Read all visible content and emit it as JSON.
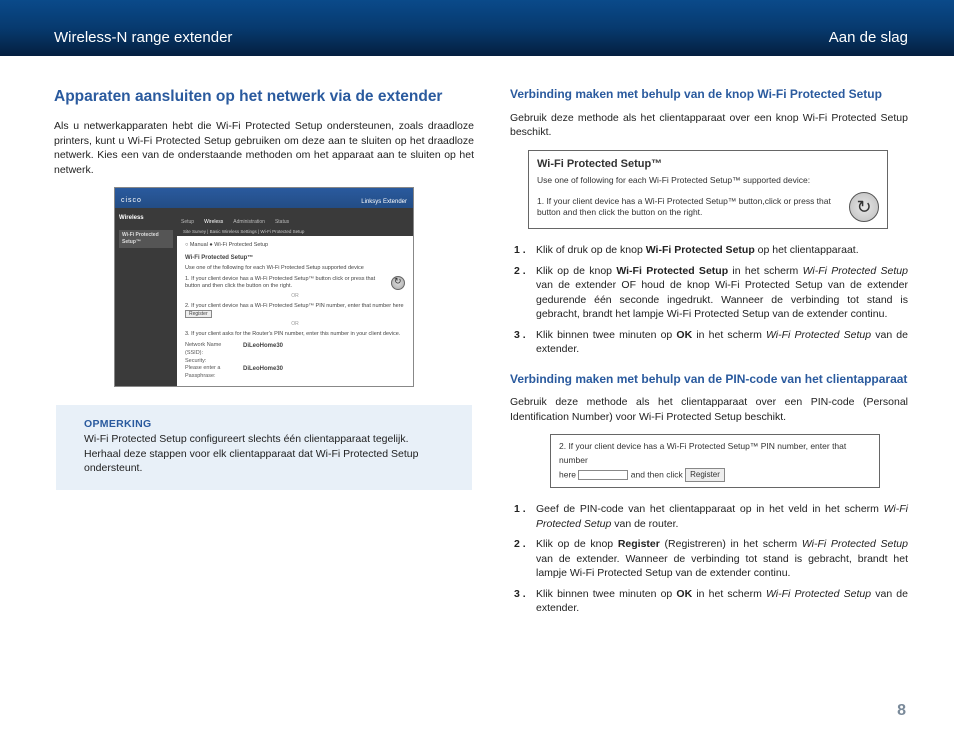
{
  "header": {
    "left": "Wireless-N range extender",
    "right": "Aan de slag"
  },
  "left_col": {
    "title": "Apparaten aansluiten op het netwerk via de extender",
    "intro": "Als u netwerkapparaten hebt die Wi-Fi Protected Setup ondersteunen, zoals draadloze printers, kunt u Wi-Fi Protected Setup gebruiken om deze aan te sluiten op het draadloze netwerk. Kies een van de onderstaande methoden om het apparaat aan te sluiten op het netwerk.",
    "screenshot": {
      "logo": "cisco",
      "brand": "Linksys Extender",
      "side_label": "Wireless",
      "side_tab": "Wi-Fi Protected Setup™",
      "tabs": [
        "Setup",
        "Wireless",
        "Administration",
        "Status"
      ],
      "subtabs": "Site Survey   |   Basic Wireless Settings   |   Wi-Fi Protected Setup",
      "radio": "○ Manual   ● Wi-Fi Protected Setup",
      "wps_title": "Wi-Fi Protected Setup™",
      "wps_sub": "Use one of the following for each Wi-Fi Protected Setup supported device",
      "step1": "1. If your client device has a Wi-Fi Protected Setup™ button click or press that button and then click the button on the right.",
      "or": "OR",
      "step2": "2. If your client device has a Wi-Fi Protected Setup™ PIN number, enter that number here",
      "register": "Register",
      "step3": "3. If your client asks for the Router's PIN number, enter this number in your client device.",
      "nn_label": "Network Name (SSID):",
      "nn_val": "DiLeoHome30",
      "sec_label": "Security:",
      "pp_label": "Please enter a Passphrase:",
      "pp_val": "DiLeoHome30"
    },
    "note": {
      "title": "Opmerking",
      "body": "Wi-Fi Protected Setup configureert slechts één clientapparaat tegelijk. Herhaal deze stappen voor elk clientapparaat dat Wi-Fi Protected Setup ondersteunt."
    }
  },
  "right_col": {
    "sub1_title": "Verbinding maken met behulp van de knop Wi-Fi Protected Setup",
    "sub1_intro": "Gebruik deze methode als het clientapparaat over een knop Wi-Fi Protected Setup beschikt.",
    "wps_box": {
      "title": "Wi-Fi Protected Setup™",
      "sub": "Use one of following for each Wi-Fi Protected Setup™ supported device:",
      "text": "1. If your client device has a Wi-Fi Protected Setup™ button,click or press that button and then click the button on the right."
    },
    "steps1": [
      {
        "n": "1 .",
        "pre": "Klik of druk op de knop ",
        "b1": "Wi-Fi Protected Setup",
        "post": " op het clientapparaat."
      },
      {
        "n": "2 .",
        "html": "Klik op de knop <b>Wi-Fi Protected Setup</b> in het scherm <i>Wi-Fi Protected Setup</i> van de extender OF houd de knop Wi-Fi Protected Setup van de extender gedurende één seconde ingedrukt. Wanneer de verbinding tot stand is gebracht, brandt het lampje Wi-Fi Protected Setup van de extender continu."
      },
      {
        "n": "3 .",
        "html": "Klik binnen twee minuten op <b>OK</b> in het scherm <i>Wi-Fi Protected Setup</i> van de extender."
      }
    ],
    "sub2_title": "Verbinding maken met behulp van de PIN-code van het clientapparaat",
    "sub2_intro": "Gebruik deze methode als het clientapparaat over een PIN-code (Personal Identification Number) voor Wi-Fi Protected Setup beschikt.",
    "pin_box": {
      "line1": "2. If your client device has a Wi-Fi Protected Setup™ PIN number, enter that number",
      "line2a": "here",
      "line2b": "and then click",
      "register": "Register"
    },
    "steps2": [
      {
        "n": "1 .",
        "html": "Geef de PIN-code van het clientapparaat op in het veld in het scherm <i>Wi-Fi Protected Setup</i> van de router."
      },
      {
        "n": "2 .",
        "html": "Klik op de knop <b>Register</b> (Registreren) in het scherm <i>Wi-Fi Protected Setup</i> van de extender. Wanneer de verbinding tot stand is gebracht, brandt het lampje Wi-Fi Protected Setup van de extender continu."
      },
      {
        "n": "3 .",
        "html": "Klik binnen twee minuten op <b>OK</b> in het scherm <i>Wi-Fi Protected Setup</i> van de extender."
      }
    ]
  },
  "page_number": "8"
}
